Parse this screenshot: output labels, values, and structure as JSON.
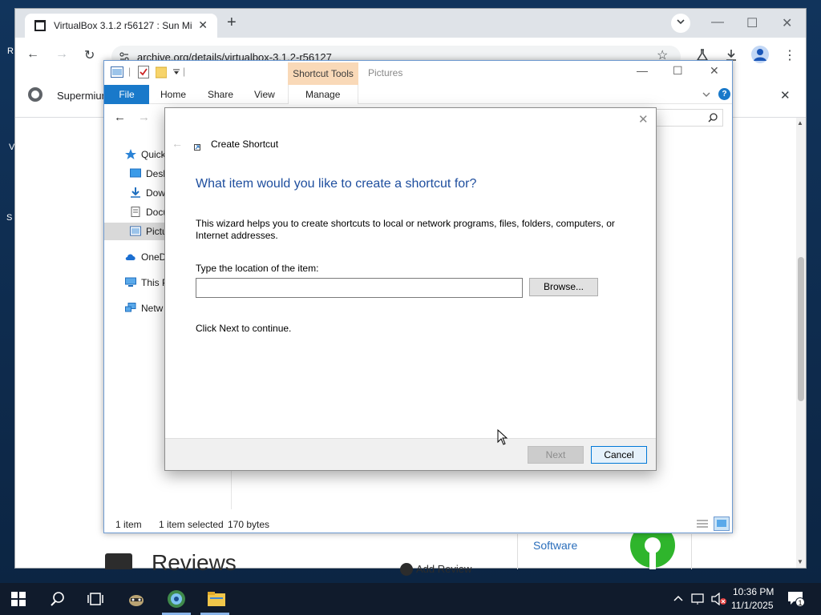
{
  "desktop": {
    "fragments": [
      "R",
      "V",
      "S"
    ]
  },
  "browser": {
    "tab_title": "VirtualBox 3.1.2 r56127 : Sun Mi",
    "tab_close": "✕",
    "new_tab": "+",
    "url": "archive.org/details/virtualbox-3.1.2-r56127",
    "bookmark_text": "Supermium",
    "page": {
      "reviews_heading": "Reviews",
      "add_review": "Add Review",
      "software_link": "Software"
    }
  },
  "explorer": {
    "context_tab": "Shortcut Tools",
    "folder_title": "Pictures",
    "ribbon_tabs": [
      "File",
      "Home",
      "Share",
      "View",
      "Manage"
    ],
    "nav_items": [
      {
        "label": "Quick",
        "icon": "star-icon"
      },
      {
        "label": "Desk",
        "icon": "desktop-icon"
      },
      {
        "label": "Dow",
        "icon": "download-icon"
      },
      {
        "label": "Docu",
        "icon": "document-icon"
      },
      {
        "label": "Pictu",
        "icon": "pictures-icon"
      },
      {
        "label": "OneD",
        "icon": "cloud-icon"
      },
      {
        "label": "This P",
        "icon": "computer-icon"
      },
      {
        "label": "Netw",
        "icon": "network-icon"
      }
    ],
    "status": {
      "count": "1 item",
      "selected": "1 item selected",
      "size": "170 bytes"
    }
  },
  "dialog": {
    "title": "Create Shortcut",
    "heading": "What item would you like to create a shortcut for?",
    "description": "This wizard helps you to create shortcuts to local or network programs, files, folders, computers, or Internet addresses.",
    "location_label": "Type the location of the item:",
    "location_value": "",
    "browse_label": "Browse...",
    "continue_text": "Click Next to continue.",
    "next_label": "Next",
    "cancel_label": "Cancel"
  },
  "taskbar": {
    "time": "10:36 PM",
    "date": "11/1/2025",
    "notification_count": "1"
  },
  "colors": {
    "heading_blue": "#1e4e9e",
    "file_tab_blue": "#1979ca",
    "context_tab": "#f9d9b8"
  }
}
